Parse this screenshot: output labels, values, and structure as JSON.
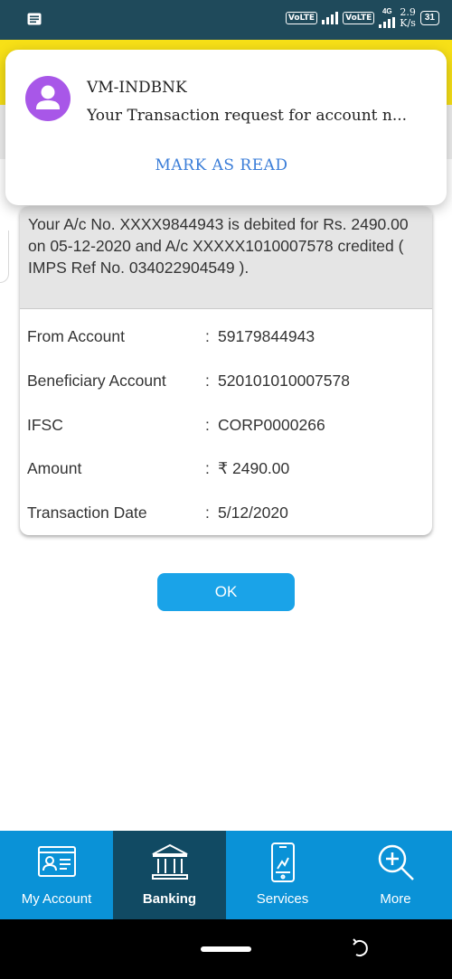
{
  "status_bar": {
    "left_icon": "message-icon",
    "volte1": "VoLTE",
    "volte2": "VoLTE",
    "network": "4G",
    "speed_value": "2.9",
    "speed_unit": "K/s",
    "battery": "31"
  },
  "notification": {
    "sender": "VM-INDBNK",
    "message": "Your Transaction request for account n...",
    "action": "MARK AS READ",
    "avatar_icon": "person-icon"
  },
  "transaction": {
    "message": "Your A/c No. XXXX9844943 is debited for Rs. 2490.00 on 05-12-2020 and A/c XXXXX1010007578 credited ( IMPS Ref No. 034022904549 ).",
    "rows": [
      {
        "label": "From Account",
        "sep": ":",
        "value": "59179844943"
      },
      {
        "label": "Beneficiary Account",
        "sep": ":",
        "value": "520101010007578"
      },
      {
        "label": "IFSC",
        "sep": ":",
        "value": "CORP0000266"
      },
      {
        "label": "Amount",
        "sep": ":",
        "value": "₹ 2490.00"
      },
      {
        "label": "Transaction Date",
        "sep": ":",
        "value": "5/12/2020"
      }
    ]
  },
  "ok_button": "OK",
  "bottom_nav": [
    {
      "label": "My Account",
      "icon": "account-card-icon",
      "active": false
    },
    {
      "label": "Banking",
      "icon": "bank-icon",
      "active": true
    },
    {
      "label": "Services",
      "icon": "mobile-services-icon",
      "active": false
    },
    {
      "label": "More",
      "icon": "zoom-plus-icon",
      "active": false
    }
  ],
  "colors": {
    "status_bar": "#1f4a5b",
    "accent_blue": "#0a92d7",
    "active_tab": "#114a63",
    "ok_button": "#1aa3e8",
    "notif_action": "#3a7dd8",
    "avatar": "#a857e8"
  }
}
